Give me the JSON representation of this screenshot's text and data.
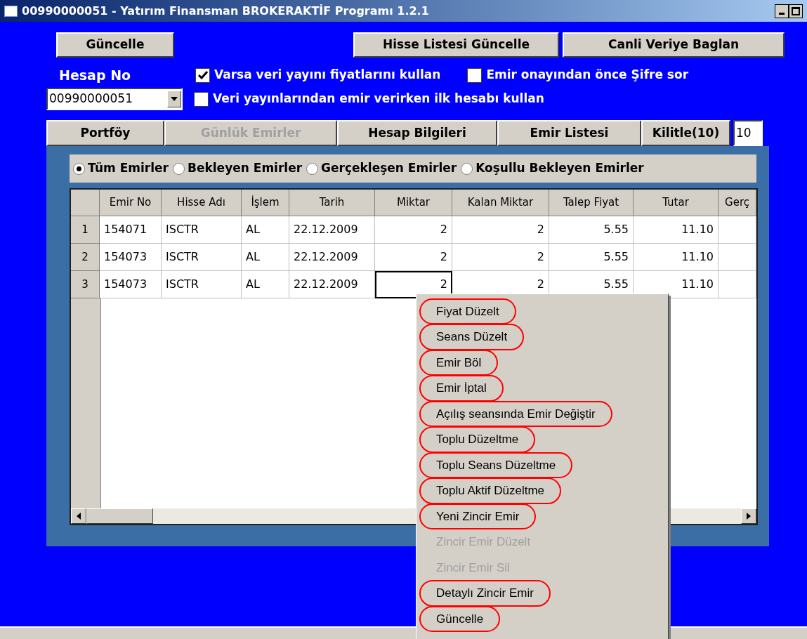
{
  "window": {
    "title": "00990000051 - Yatırım Finansman BROKERAKTİF Programı 1.2.1"
  },
  "top_buttons": [
    {
      "label": "Güncelle"
    },
    {
      "label": "Hisse Listesi Güncelle"
    },
    {
      "label": "Canli Veriye Baglan"
    }
  ],
  "account": {
    "label": "Hesap No",
    "value": "00990000051"
  },
  "options": [
    {
      "label": "Varsa veri yayını fiyatlarını kullan",
      "checked": true
    },
    {
      "label": "Emir onayından önce Şifre sor",
      "checked": false
    },
    {
      "label": "Veri yayınlarından emir verirken ilk hesabı kullan",
      "checked": false
    }
  ],
  "tabs": [
    {
      "label": "Portföy",
      "disabled": false
    },
    {
      "label": "Günlük Emirler",
      "disabled": true
    },
    {
      "label": "Hesap Bilgileri",
      "disabled": false
    },
    {
      "label": "Emir Listesi",
      "disabled": false
    },
    {
      "label": "Kilitle(10)",
      "disabled": false
    }
  ],
  "lock_field": {
    "value": "10"
  },
  "filters": [
    {
      "label": "Tüm Emirler",
      "selected": true
    },
    {
      "label": "Bekleyen Emirler",
      "selected": false
    },
    {
      "label": "Gerçekleşen Emirler",
      "selected": false
    },
    {
      "label": "Koşullu Bekleyen Emirler",
      "selected": false
    }
  ],
  "table": {
    "columns": [
      "Emir No",
      "Hisse Adı",
      "İşlem",
      "Tarih",
      "Miktar",
      "Kalan Miktar",
      "Talep Fiyat",
      "Tutar",
      "Gerç"
    ],
    "rows": [
      {
        "index": "1",
        "cells": [
          "154071",
          "ISCTR",
          "AL",
          "22.12.2009",
          "2",
          "2",
          "5.55",
          "11.10",
          ""
        ],
        "focused_cell": false
      },
      {
        "index": "2",
        "cells": [
          "154073",
          "ISCTR",
          "AL",
          "22.12.2009",
          "2",
          "2",
          "5.55",
          "11.10",
          ""
        ],
        "focused_cell": false
      },
      {
        "index": "3",
        "cells": [
          "154073",
          "ISCTR",
          "AL",
          "22.12.2009",
          "2",
          "2",
          "5.55",
          "11.10",
          ""
        ],
        "focused_cell": true
      }
    ]
  },
  "context_menu": {
    "items": [
      {
        "label": "Fiyat Düzelt",
        "disabled": false,
        "circled": true
      },
      {
        "label": "Seans Düzelt",
        "disabled": false,
        "circled": true
      },
      {
        "label": "Emir Böl",
        "disabled": false,
        "circled": true
      },
      {
        "label": "Emir İptal",
        "disabled": false,
        "circled": true
      },
      {
        "label": "Açılış seansında Emir Değiştir",
        "disabled": false,
        "circled": true
      },
      {
        "label": "Toplu Düzeltme",
        "disabled": false,
        "circled": true
      },
      {
        "label": "Toplu Seans Düzeltme",
        "disabled": false,
        "circled": true
      },
      {
        "label": "Toplu Aktif Düzeltme",
        "disabled": false,
        "circled": true
      },
      {
        "label": "Yeni Zincir Emir",
        "disabled": false,
        "circled": true
      },
      {
        "label": "Zincir Emir Düzelt",
        "disabled": true,
        "circled": false
      },
      {
        "label": "Zincir Emir Sil",
        "disabled": true,
        "circled": false
      },
      {
        "label": "Detaylı Zincir Emir",
        "disabled": false,
        "circled": true
      },
      {
        "label": "Güncelle",
        "disabled": false,
        "circled": true
      }
    ]
  }
}
